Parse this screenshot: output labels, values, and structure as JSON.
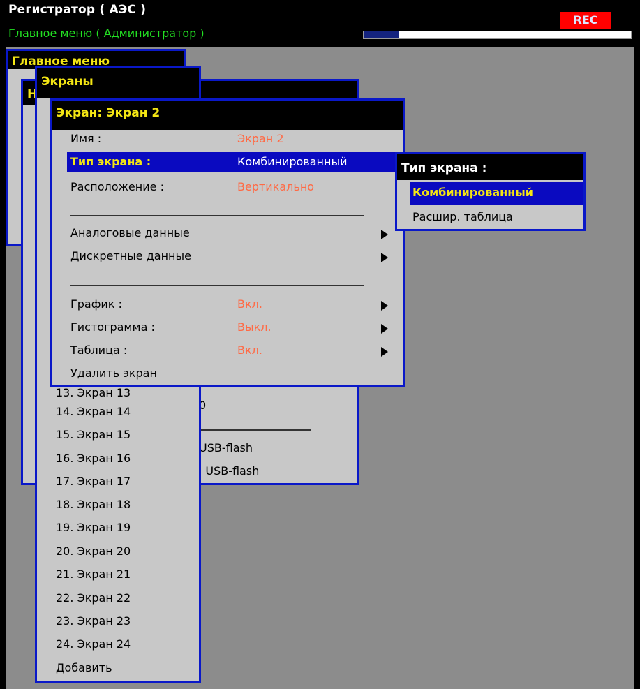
{
  "header": {
    "title": "Регистратор ( АЭС )",
    "subtitle": "Главное меню ( Администратор )",
    "rec_label": "REC",
    "progress": 0.13
  },
  "main_menu": {
    "title": "Главное меню"
  },
  "second_menu": {
    "title_initial": "Н",
    "fragments": [
      "0",
      "USB-flash",
      "на USB-flash"
    ]
  },
  "screens_menu": {
    "title": "Экраны",
    "items": [
      "13. Экран 13",
      "14. Экран 14",
      "15. Экран 15",
      "16. Экран 16",
      "17. Экран 17",
      "18. Экран 18",
      "19. Экран 19",
      "20. Экран 20",
      "21. Экран 21",
      "22. Экран 22",
      "23. Экран 23",
      "24. Экран 24",
      "Добавить"
    ]
  },
  "screen_menu": {
    "title": "Экран: Экран 2",
    "rows": {
      "name_label": "Имя :",
      "name_value": "Экран 2",
      "type_label": "Тип экрана :",
      "type_value": "Комбинированный",
      "layout_label": "Расположение :",
      "layout_value": "Вертикально",
      "analog_label": "Аналоговые данные",
      "discrete_label": "Дискретные данные",
      "graph_label": "График :",
      "graph_value": "Вкл.",
      "histogram_label": "Гистограмма :",
      "histogram_value": "Выкл.",
      "table_label": "Таблица :",
      "table_value": "Вкл.",
      "delete_label": "Удалить экран"
    }
  },
  "type_menu": {
    "title": "Тип экрана :",
    "options": [
      "Комбинированный",
      "Расшир. таблица"
    ],
    "selected_index": 0
  },
  "colors": {
    "background": "#8c8c8c",
    "menu_bg": "#c8c8c8",
    "menu_border": "#0a18c8",
    "title_text": "#f4e614",
    "highlight": "#0a0ac0",
    "value_text": "#ff6a45",
    "subtitle_text": "#22e022",
    "rec_bg": "#ff0000"
  }
}
